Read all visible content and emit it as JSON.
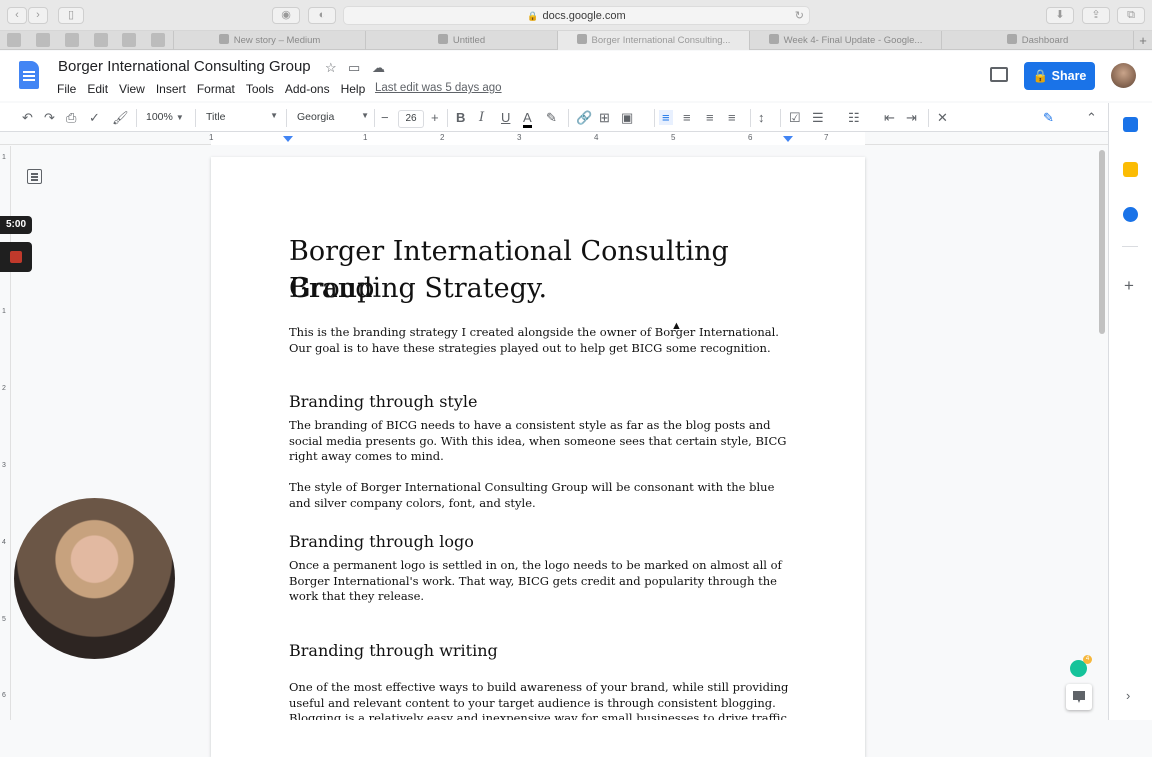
{
  "browser": {
    "url": "docs.google.com",
    "tabs": [
      {
        "label": "New story – Medium"
      },
      {
        "label": "Untitled"
      },
      {
        "label": "Borger International Consulting..."
      },
      {
        "label": "Week 4- Final Update - Google..."
      },
      {
        "label": "Dashboard"
      }
    ],
    "new_tab_glyph": "+"
  },
  "docs": {
    "title": "Borger International Consulting Group",
    "menu": [
      "File",
      "Edit",
      "View",
      "Insert",
      "Format",
      "Tools",
      "Add-ons",
      "Help"
    ],
    "last_edit": "Last edit was 5 days ago",
    "share_label": "Share"
  },
  "toolbar": {
    "zoom": "100%",
    "style": "Title",
    "font": "Georgia",
    "font_size": "26"
  },
  "ruler_numbers": [
    "1",
    "1",
    "2",
    "3",
    "4",
    "5",
    "6",
    "7"
  ],
  "vruler_numbers": [
    "1",
    "1",
    "2",
    "3",
    "4",
    "5",
    "6"
  ],
  "recorder": {
    "timer": "5:00"
  },
  "grammarly_count": "4",
  "document": {
    "title_line1": "Borger International Consulting Group",
    "title_line2": "Branding Strategy.",
    "intro": "This is the branding strategy I created alongside the owner of Borger International. Our goal is to have these strategies played out to help get BICG some recognition.",
    "sections": [
      {
        "heading": "Branding through style",
        "paragraphs": [
          "The branding of BICG needs to have a consistent style as far as the blog posts and social media presents go. With this idea, when someone sees that certain style, BICG right away comes to mind.",
          "The style of Borger International Consulting Group will be consonant with the blue and silver company colors, font, and style."
        ]
      },
      {
        "heading": "Branding through logo",
        "paragraphs": [
          "Once a permanent logo is settled in on, the logo needs to be marked on almost all of Borger International's work. That way, BICG gets credit and popularity through the work that they release."
        ]
      },
      {
        "heading": "Branding through writing",
        "paragraphs": [
          "One of the most effective ways to build awareness of your brand, while still providing useful and relevant content to your target audience is through consistent blogging. Blogging is a relatively easy and inexpensive way for small businesses to drive traffic to their site."
        ]
      }
    ]
  },
  "colors": {
    "accent": "#1a73e8",
    "docs_blue": "#4285f4",
    "grammarly": "#15c39a"
  }
}
